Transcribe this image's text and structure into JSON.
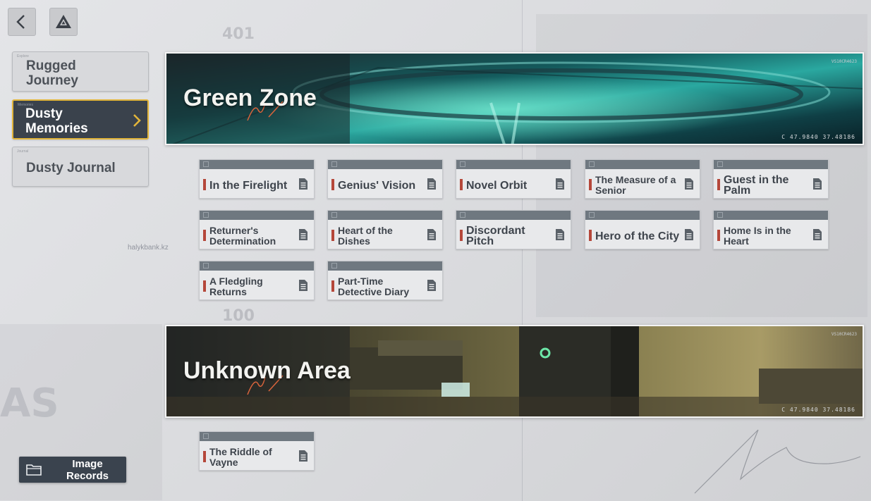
{
  "nav": {
    "back_icon": "chevron-left-icon",
    "logo_icon": "triangle-logo-icon"
  },
  "sidebar": {
    "items": [
      {
        "label": "Rugged\nJourney",
        "active": false
      },
      {
        "label": "Dusty\nMemories",
        "active": true
      },
      {
        "label": "Dusty Journal",
        "active": false
      }
    ]
  },
  "background": {
    "num1": "401",
    "num2": "100",
    "watermark": "AS",
    "site": "halykbank.kz"
  },
  "sections": [
    {
      "title": "Green Zone",
      "coords": "C  47.9840  37.48186",
      "code": "VS10CR4623",
      "cards": [
        {
          "title": "In the Firelight"
        },
        {
          "title": "Genius' Vision"
        },
        {
          "title": "Novel Orbit"
        },
        {
          "title": "The Measure of a Senior"
        },
        {
          "title": "Guest in the Palm"
        },
        {
          "title": "Returner's Determination"
        },
        {
          "title": "Heart of the Dishes"
        },
        {
          "title": "Discordant Pitch"
        },
        {
          "title": "Hero of the City"
        },
        {
          "title": "Home Is in the Heart"
        },
        {
          "title": "A Fledgling Returns"
        },
        {
          "title": "Part-Time Detective Diary"
        }
      ]
    },
    {
      "title": "Unknown Area",
      "coords": "C  47.9840  37.48186",
      "code": "VS10CR4623",
      "cards": [
        {
          "title": "The Riddle of Vayne"
        }
      ]
    }
  ],
  "footer": {
    "image_records_label": "Image\nRecords",
    "folder_icon": "folder-icon"
  },
  "colors": {
    "accent": "#e2b53a",
    "card_bar": "#b5473a",
    "active_bg": "#3a424c"
  }
}
